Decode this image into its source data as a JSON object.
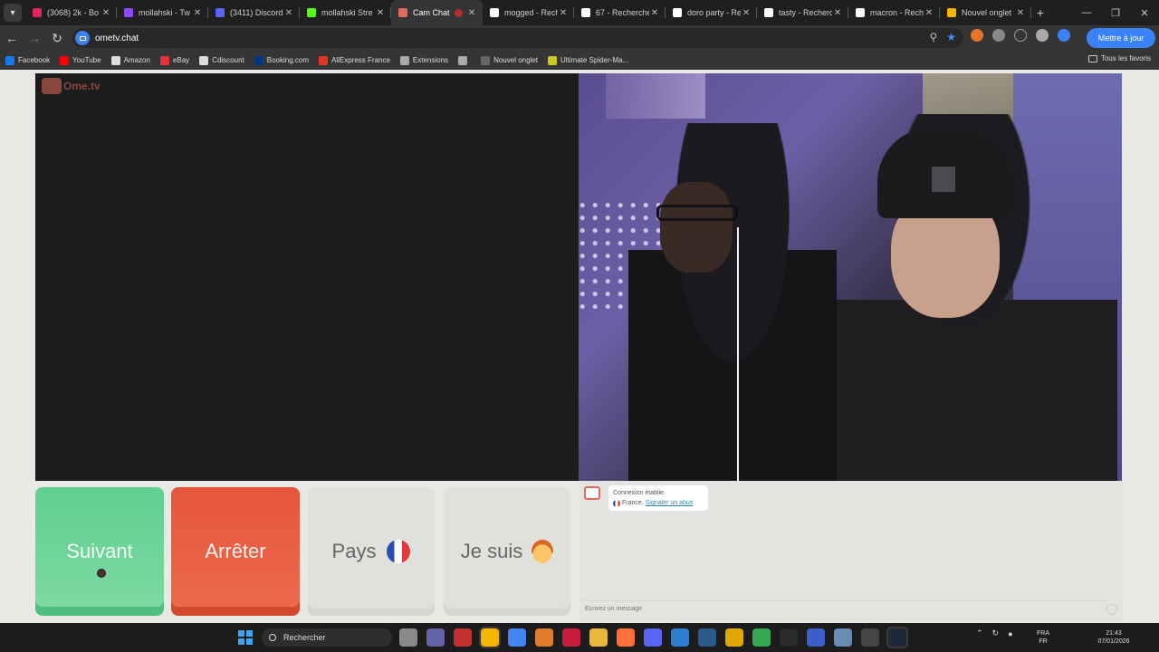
{
  "browser": {
    "tabs": [
      {
        "title": "(3068) 2k - Bo",
        "favicon_color": "#e0245e"
      },
      {
        "title": "mollahski - Tw",
        "favicon_color": "#9146ff"
      },
      {
        "title": "(3411) Discord",
        "favicon_color": "#5865f2"
      },
      {
        "title": "mollahski Stre",
        "favicon_color": "#53fc18"
      },
      {
        "title": "Cam Chat",
        "favicon_color": "#e26a5c",
        "active": true
      },
      {
        "title": "mogged - Rech",
        "favicon_color": "#ffffff"
      },
      {
        "title": "67 - Recherche",
        "favicon_color": "#ffffff"
      },
      {
        "title": "doro party - Re",
        "favicon_color": "#ffffff"
      },
      {
        "title": "tasty - Recherc",
        "favicon_color": "#ffffff"
      },
      {
        "title": "macron - Rech",
        "favicon_color": "#ffffff"
      },
      {
        "title": "Nouvel onglet",
        "favicon_color": "#f5b400"
      }
    ],
    "url": "ometv.chat",
    "update_button": "Mettre à jour",
    "bookmarks": [
      {
        "label": "Facebook",
        "icon_color": "#1877f2"
      },
      {
        "label": "YouTube",
        "icon_color": "#ff0000"
      },
      {
        "label": "Amazon",
        "icon_color": "#dddddd"
      },
      {
        "label": "eBay",
        "icon_color": "#e53238"
      },
      {
        "label": "Cdiscount",
        "icon_color": "#dddddd"
      },
      {
        "label": "Booking.com",
        "icon_color": "#003580"
      },
      {
        "label": "AliExpress France",
        "icon_color": "#e43225"
      },
      {
        "label": "Extensions",
        "icon_color": "#aaaaaa"
      },
      {
        "label": "",
        "icon_color": "#aaaaaa"
      },
      {
        "label": "Nouvel onglet",
        "icon_color": "#666666"
      },
      {
        "label": "Ultimate Spider-Ma...",
        "icon_color": "#c8c81e"
      }
    ],
    "all_bookmarks": "Tous les favoris"
  },
  "site": {
    "logo_text": "Ome.tv",
    "buttons": {
      "next": "Suivant",
      "stop": "Arrêter",
      "country": "Pays",
      "i_am": "Je suis"
    },
    "chat": {
      "status": "Connexion établie.",
      "country": "France.",
      "report_link": "Signaler un abus",
      "input_placeholder": "Écrivez un message"
    }
  },
  "taskbar": {
    "search_label": "Rechercher",
    "lang_line1": "FRA",
    "lang_line2": "FR",
    "time": "21:43",
    "date": "07/01/2026"
  },
  "colors": {
    "next": "#5fcf8f",
    "stop": "#e7563c",
    "accent": "#3b82f6"
  }
}
